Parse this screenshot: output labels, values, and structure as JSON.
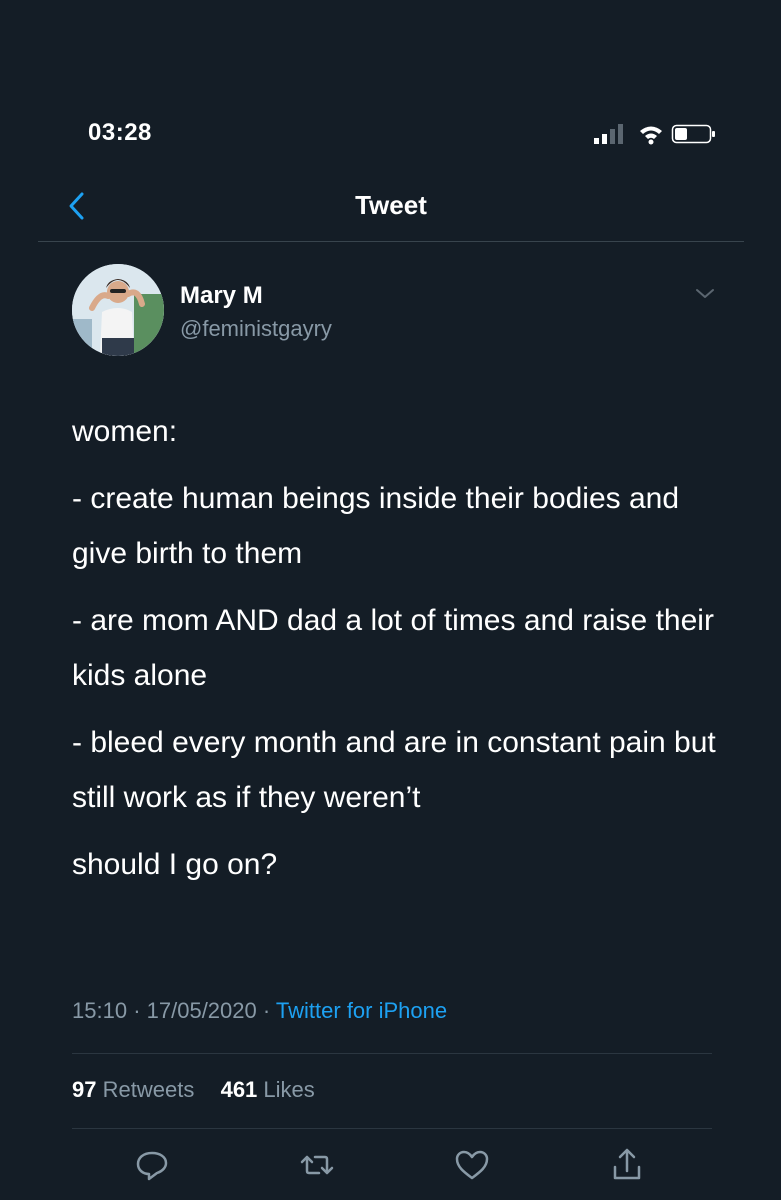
{
  "status_bar": {
    "time": "03:28",
    "icons": [
      "signal-icon",
      "wifi-icon",
      "battery-icon"
    ]
  },
  "nav": {
    "title": "Tweet",
    "back_icon": "chevron-left-icon"
  },
  "tweet": {
    "author_name": "Mary M",
    "author_handle": "@feministgayry",
    "paragraphs": [
      "women:",
      "- create human beings inside their bodies and give birth to them",
      "- are mom AND dad a lot of times and raise their kids alone",
      "- bleed every month and are in constant pain but still work as if they weren’t",
      "should I go on?"
    ],
    "time": "15:10",
    "date": "17/05/2020",
    "source": "Twitter for iPhone",
    "retweets": "97",
    "retweets_label": "Retweets",
    "likes": "461",
    "likes_label": "Likes"
  },
  "actions": [
    "reply-icon",
    "retweet-icon",
    "like-icon",
    "share-icon"
  ],
  "colors": {
    "background": "#141d26",
    "text": "#ffffff",
    "secondary": "#8899a6",
    "accent": "#1da1f2",
    "divider": "#38444d"
  }
}
